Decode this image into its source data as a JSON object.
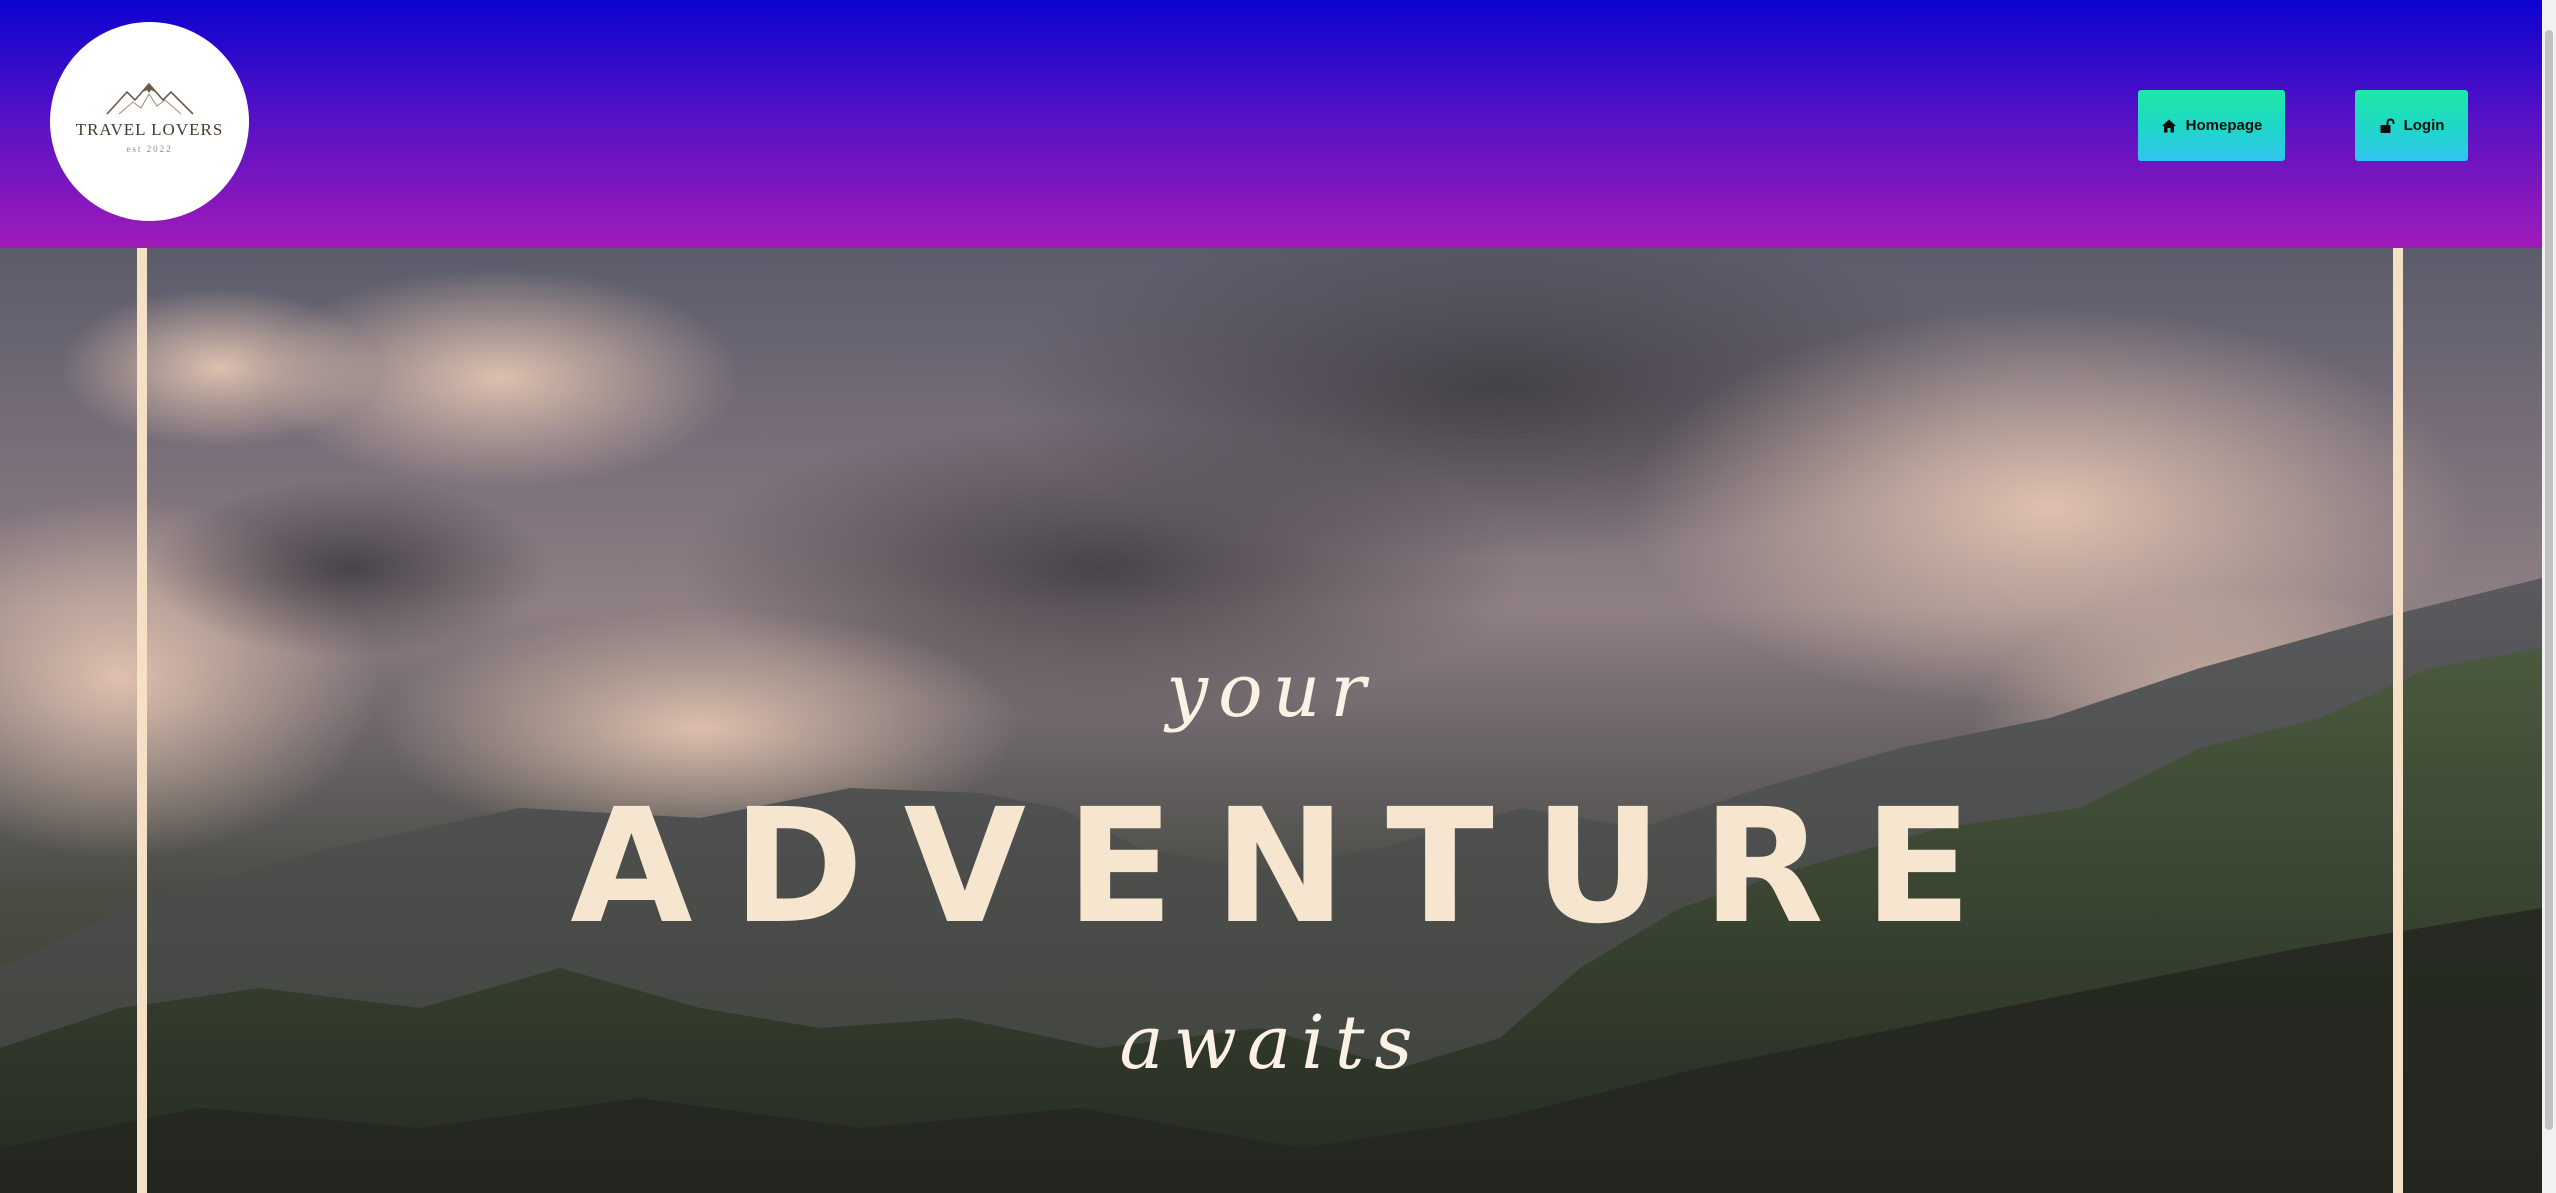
{
  "header": {
    "logo": {
      "name": "TRAVEL LOVERS",
      "est": "est 2022"
    },
    "nav": {
      "homepage_label": "Homepage",
      "login_label": "Login"
    },
    "colors": {
      "gradient_top": "#0b03cf",
      "gradient_bottom": "#a01bb8",
      "button": "#1ee8a6"
    }
  },
  "hero": {
    "line_top": "your",
    "line_main": "ADVENTURE",
    "line_bottom": "awaits",
    "colors": {
      "frame": "#f5dfc5",
      "title": "#f7e6cf"
    }
  }
}
